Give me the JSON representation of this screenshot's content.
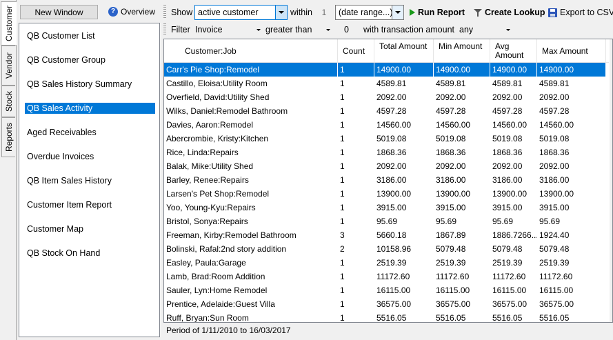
{
  "vtabs": [
    "Customer",
    "Vendor",
    "Stock",
    "Reports"
  ],
  "left": {
    "new_window_label": "New Window",
    "overview_label": "Overview",
    "reports": [
      "QB Customer List",
      "QB Customer Group",
      "QB Sales History Summary",
      "QB Sales Activity",
      "Aged Receivables",
      "Overdue Invoices",
      "QB Item Sales History",
      "Customer Item Report",
      "Customer Map",
      "QB Stock On Hand"
    ],
    "selected_report": "QB Sales Activity"
  },
  "toolbar": {
    "show_label": "Show",
    "show_value": "active customer",
    "within_label": "within",
    "within_number": "1",
    "range_value": "(date range...)",
    "run_label": "Run Report",
    "lookup_label": "Create Lookup",
    "export_label": "Export to CSV"
  },
  "filterbar": {
    "filter_label": "Filter",
    "type_value": "Invoice",
    "op_value": "greater than",
    "amount_value": "0",
    "with_label": "with transaction amount",
    "any_value": "any"
  },
  "grid": {
    "columns": [
      "Customer:Job",
      "Count",
      "Total Amount",
      "Min Amount",
      "Avg Amount",
      "Max Amount"
    ],
    "rows": [
      [
        "Carr's Pie Shop:Remodel",
        "1",
        "14900.00",
        "14900.00",
        "14900.00",
        "14900.00"
      ],
      [
        "Castillo, Eloisa:Utility Room",
        "1",
        "4589.81",
        "4589.81",
        "4589.81",
        "4589.81"
      ],
      [
        "Overfield, David:Utility Shed",
        "1",
        "2092.00",
        "2092.00",
        "2092.00",
        "2092.00"
      ],
      [
        "Wilks, Daniel:Remodel Bathroom",
        "1",
        "4597.28",
        "4597.28",
        "4597.28",
        "4597.28"
      ],
      [
        "Davies, Aaron:Remodel",
        "1",
        "14560.00",
        "14560.00",
        "14560.00",
        "14560.00"
      ],
      [
        "Abercrombie, Kristy:Kitchen",
        "1",
        "5019.08",
        "5019.08",
        "5019.08",
        "5019.08"
      ],
      [
        "Rice, Linda:Repairs",
        "1",
        "1868.36",
        "1868.36",
        "1868.36",
        "1868.36"
      ],
      [
        "Balak, Mike:Utility Shed",
        "1",
        "2092.00",
        "2092.00",
        "2092.00",
        "2092.00"
      ],
      [
        "Barley, Renee:Repairs",
        "1",
        "3186.00",
        "3186.00",
        "3186.00",
        "3186.00"
      ],
      [
        "Larsen's Pet Shop:Remodel",
        "1",
        "13900.00",
        "13900.00",
        "13900.00",
        "13900.00"
      ],
      [
        "Yoo, Young-Kyu:Repairs",
        "1",
        "3915.00",
        "3915.00",
        "3915.00",
        "3915.00"
      ],
      [
        "Bristol, Sonya:Repairs",
        "1",
        "95.69",
        "95.69",
        "95.69",
        "95.69"
      ],
      [
        "Freeman, Kirby:Remodel Bathroom",
        "3",
        "5660.18",
        "1867.89",
        "1886.7266...",
        "1924.40"
      ],
      [
        "Bolinski, Rafal:2nd story addition",
        "2",
        "10158.96",
        "5079.48",
        "5079.48",
        "5079.48"
      ],
      [
        "Easley, Paula:Garage",
        "1",
        "2519.39",
        "2519.39",
        "2519.39",
        "2519.39"
      ],
      [
        "Lamb, Brad:Room Addition",
        "1",
        "11172.60",
        "11172.60",
        "11172.60",
        "11172.60"
      ],
      [
        "Sauler, Lyn:Home Remodel",
        "1",
        "16115.00",
        "16115.00",
        "16115.00",
        "16115.00"
      ],
      [
        "Prentice, Adelaide:Guest Villa",
        "1",
        "36575.00",
        "36575.00",
        "36575.00",
        "36575.00"
      ],
      [
        "Ruff, Bryan:Sun Room",
        "1",
        "5516.05",
        "5516.05",
        "5516.05",
        "5516.05"
      ]
    ]
  },
  "status": {
    "period_text": "Period of 1/11/2010 to 16/03/2017"
  },
  "colors": {
    "selection": "#0078d7",
    "run_icon": "#1a9a1a"
  }
}
